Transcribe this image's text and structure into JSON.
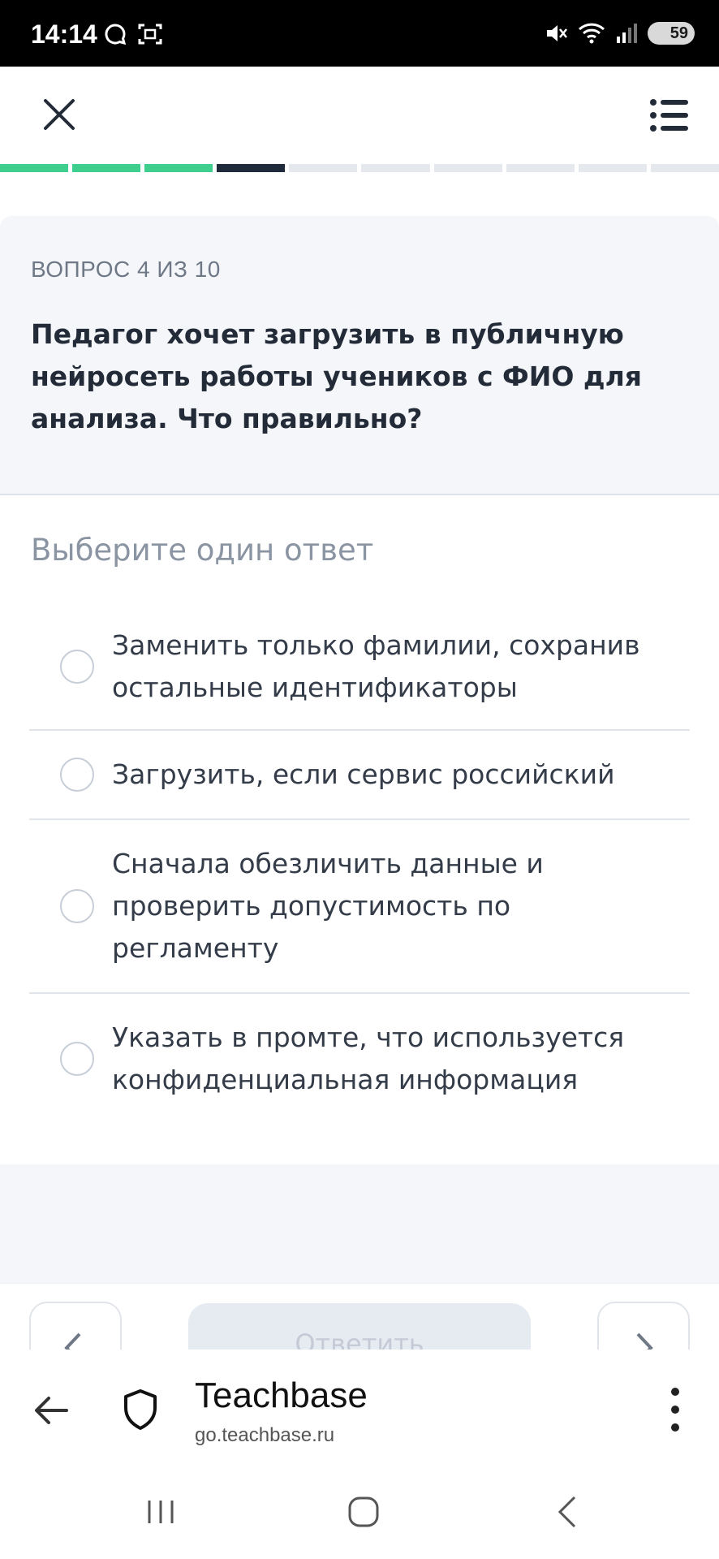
{
  "status_bar": {
    "time": "14:14",
    "battery": "59",
    "icons": [
      "chat-bubble-icon",
      "screenshot-icon",
      "mute-icon",
      "wifi-icon",
      "signal-icon",
      "battery-icon"
    ]
  },
  "header": {
    "close_icon": "close-icon",
    "menu_icon": "list-menu-icon"
  },
  "progress": {
    "total": 10,
    "current": 4,
    "completed": 3,
    "colors": {
      "done": "#3ecf8e",
      "current": "#1f2b3a",
      "todo": "#e5e9ee"
    }
  },
  "question": {
    "counter": "ВОПРОС 4 ИЗ 10",
    "text": "Педагог хочет загрузить в публичную нейросеть работы учеников с ФИО для анализа. Что правильно?"
  },
  "instruction": "Выберите один ответ",
  "options": [
    {
      "label": "Заменить только фамилии, сохранив остальные идентификаторы",
      "selected": false
    },
    {
      "label": "Загрузить, если сервис российский",
      "selected": false
    },
    {
      "label": "Сначала обезличить данные и проверить допустимость по регламенту",
      "selected": false
    },
    {
      "label": "Указать в промте, что используется конфиденциальная информация",
      "selected": false
    }
  ],
  "bottom_nav": {
    "answer_label": "Ответить",
    "prev_icon": "chevron-left-icon",
    "next_icon": "chevron-right-icon"
  },
  "browser": {
    "title": "Teachbase",
    "url": "go.teachbase.ru",
    "back_icon": "arrow-left-icon",
    "security_icon": "shield-icon",
    "more_icon": "kebab-menu-icon"
  },
  "system_nav": {
    "icons": [
      "recent-apps-icon",
      "home-icon",
      "back-icon"
    ]
  }
}
